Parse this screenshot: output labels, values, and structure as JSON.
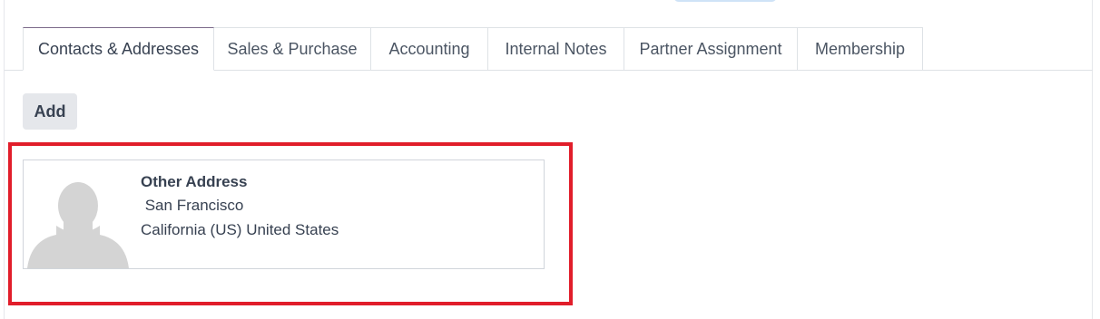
{
  "tabs": [
    {
      "label": "Contacts & Addresses",
      "active": true
    },
    {
      "label": "Sales & Purchase",
      "active": false
    },
    {
      "label": "Accounting",
      "active": false
    },
    {
      "label": "Internal Notes",
      "active": false
    },
    {
      "label": "Partner Assignment",
      "active": false
    },
    {
      "label": "Membership",
      "active": false
    }
  ],
  "contacts": {
    "add_label": "Add",
    "card": {
      "title": "Other Address",
      "line1": " San Francisco",
      "line2": "California (US) United States",
      "avatar_icon": "person-placeholder-icon"
    }
  },
  "colors": {
    "highlight_border": "#e11d2a",
    "avatar_fill": "#d4d4d4"
  }
}
